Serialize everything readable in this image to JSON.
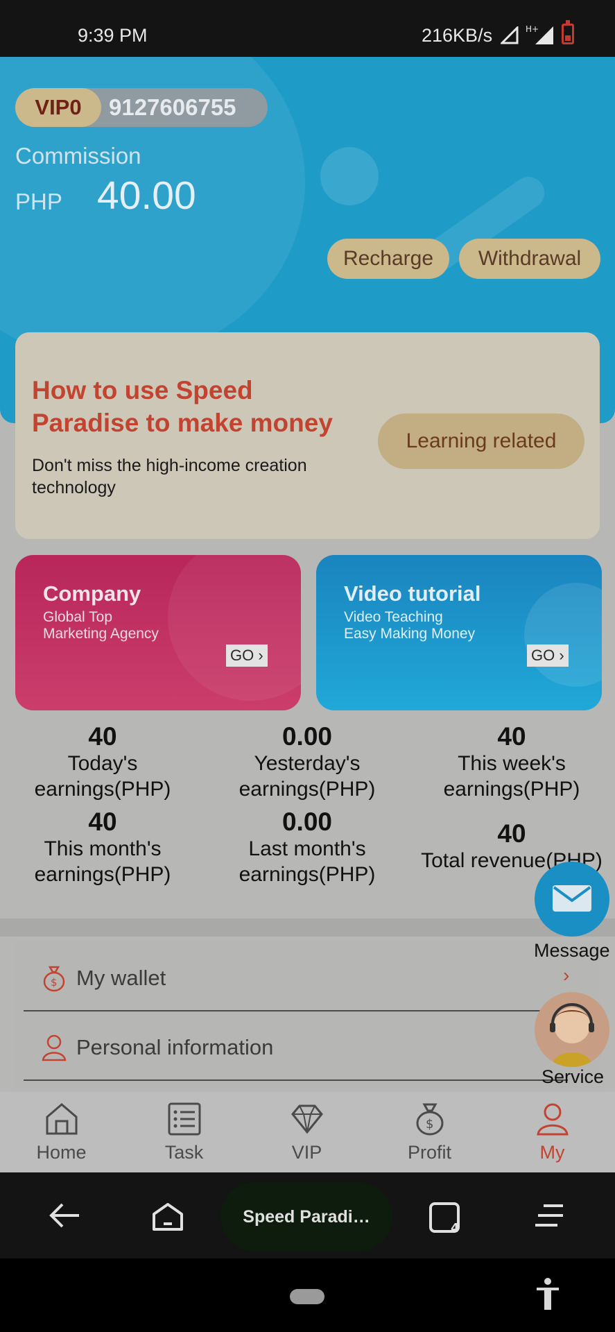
{
  "status_bar": {
    "time": "9:39 PM",
    "network_speed": "216KB/s"
  },
  "header": {
    "vip_level": "VIP0",
    "phone": "9127606755",
    "commission_label": "Commission",
    "currency": "PHP",
    "amount": "40.00",
    "recharge_label": "Recharge",
    "withdrawal_label": "Withdrawal"
  },
  "learn_card": {
    "title": "How to use Speed Paradise to make money",
    "subtitle": "Don't miss the high-income creation technology",
    "button_label": "Learning related"
  },
  "tiles": [
    {
      "title": "Company",
      "line1": "Global Top",
      "line2": "Marketing Agency",
      "go": "GO"
    },
    {
      "title": "Video tutorial",
      "line1": "Video Teaching",
      "line2": "Easy Making Money",
      "go": "GO"
    }
  ],
  "stats": [
    {
      "value": "40",
      "label_line1": "Today's",
      "label_line2": "earnings(PHP)"
    },
    {
      "value": "0.00",
      "label_line1": "Yesterday's",
      "label_line2": "earnings(PHP)"
    },
    {
      "value": "40",
      "label_line1": "This week's",
      "label_line2": "earnings(PHP)"
    },
    {
      "value": "40",
      "label_line1": "This month's",
      "label_line2": "earnings(PHP)"
    },
    {
      "value": "0.00",
      "label_line1": "Last month's",
      "label_line2": "earnings(PHP)"
    },
    {
      "value": "40",
      "label_line1": "Total revenue(PHP)"
    }
  ],
  "menu": [
    {
      "label": "My wallet",
      "icon": "money-bag-icon"
    },
    {
      "label": "Personal information",
      "icon": "user-icon"
    }
  ],
  "floating": {
    "message_label": "Message",
    "service_label": "Service"
  },
  "tabs": [
    {
      "label": "Home",
      "icon": "home-icon"
    },
    {
      "label": "Task",
      "icon": "task-list-icon"
    },
    {
      "label": "VIP",
      "icon": "diamond-icon"
    },
    {
      "label": "Profit",
      "icon": "money-bag-icon"
    },
    {
      "label": "My",
      "icon": "user-icon",
      "active": true
    }
  ],
  "browser_nav": {
    "tab_title": "Speed Paradi…",
    "tab_count": "4"
  },
  "colors": {
    "accent": "#c24430",
    "hero_blue": "#1f9bc8",
    "gold": "#cbb88b"
  }
}
